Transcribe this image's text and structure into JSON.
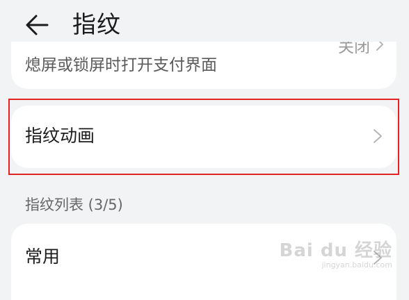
{
  "header": {
    "back_icon": "arrow-left-icon",
    "title": "指纹"
  },
  "top_card": {
    "label": "熄屏或锁屏时打开支付界面",
    "trailing": "关闭"
  },
  "animation_item": {
    "label": "指纹动画",
    "chevron_icon": "chevron-right-icon"
  },
  "fingerprint_list": {
    "header": "指纹列表 (3/5)",
    "items": [
      {
        "label": "常用"
      }
    ]
  },
  "watermark": {
    "text": "Bai du 经验",
    "sub": "jingyan.baidu.com"
  },
  "colors": {
    "background": "#f1f3f5",
    "card": "#ffffff",
    "highlight": "#e02424"
  }
}
